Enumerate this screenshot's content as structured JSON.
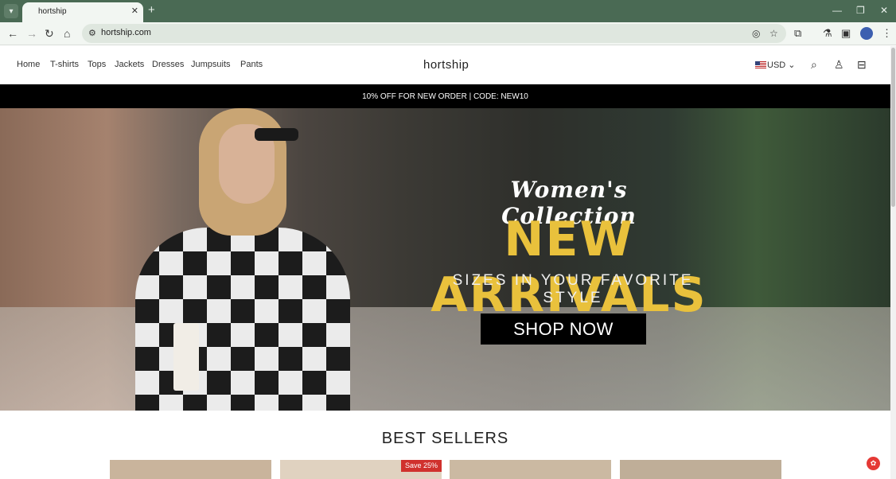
{
  "browser": {
    "tab_title": "hortship",
    "url": "hortship.com",
    "icons": [
      "tab-search-icon",
      "close-icon",
      "plus-icon",
      "minimize-icon",
      "restore-icon",
      "close-window-icon",
      "back-icon",
      "forward-icon",
      "reload-icon",
      "home-icon",
      "site-info-icon",
      "eye-off-icon",
      "star-icon",
      "extensions-icon",
      "lab-icon",
      "sidepanel-icon",
      "profile-icon",
      "menu-icon"
    ]
  },
  "header": {
    "nav": [
      "Home",
      "T-shirts",
      "Tops",
      "Jackets",
      "Dresses",
      "Jumpsuits",
      "Pants"
    ],
    "logo": "hortship",
    "currency": "USD"
  },
  "promo": "10% OFF FOR NEW ORDER | CODE: NEW10",
  "hero": {
    "script": "Women's Collection",
    "title": "NEW ARRIVALS",
    "subtitle": "SIZES IN YOUR FAVORITE STYLE",
    "cta": "SHOP NOW"
  },
  "best_sellers": {
    "title": "BEST SELLERS",
    "badge": "Save 25%"
  },
  "colors": {
    "browser_frame": "#4a6a54",
    "promo_bar": "#000000",
    "hero_title": "#e9c13c",
    "sale_badge": "#d0312d"
  }
}
